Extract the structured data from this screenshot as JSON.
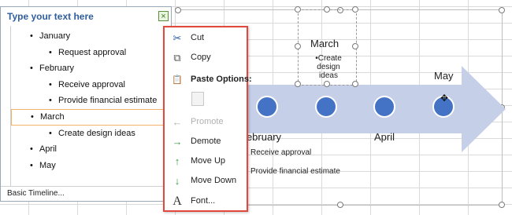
{
  "text_pane": {
    "title": "Type your text here",
    "close_glyph": "×",
    "items": [
      {
        "text": "January",
        "level": 1
      },
      {
        "text": "Request approval",
        "level": 2
      },
      {
        "text": "February",
        "level": 1
      },
      {
        "text": "Receive approval",
        "level": 2
      },
      {
        "text": "Provide financial estimate",
        "level": 2
      },
      {
        "text": "March",
        "level": 1
      },
      {
        "text": "Create design ideas",
        "level": 2
      },
      {
        "text": "April",
        "level": 1
      },
      {
        "text": "May",
        "level": 1
      }
    ],
    "footer": "Basic Timeline..."
  },
  "context_menu": {
    "cut": {
      "label": "Cut",
      "icon": "scissors-icon",
      "glyph": "✂"
    },
    "copy": {
      "label": "Copy",
      "icon": "copy-icon",
      "glyph": "⧉"
    },
    "paste_options": {
      "label": "Paste Options:",
      "icon": "clipboard-icon",
      "glyph": "📋"
    },
    "promote": {
      "label": "Promote",
      "icon": "arrow-left-icon",
      "glyph": "←",
      "enabled": false
    },
    "demote": {
      "label": "Demote",
      "icon": "arrow-right-icon",
      "glyph": "→"
    },
    "move_up": {
      "label": "Move Up",
      "icon": "arrow-up-icon",
      "glyph": "↑"
    },
    "move_down": {
      "label": "Move Down",
      "icon": "arrow-down-icon",
      "glyph": "↓"
    },
    "font": {
      "label": "Font...",
      "icon": "font-icon",
      "glyph": "A"
    }
  },
  "timeline": {
    "march": {
      "title": "March",
      "bullet": "•Create design ideas"
    },
    "may": "May",
    "april": "April",
    "february": "February",
    "feb_details": [
      "Receive approval",
      "Provide financial estimate"
    ]
  },
  "colors": {
    "arrow": "#c5cfe8",
    "circle": "#4472c4",
    "menu_border": "#e2483b",
    "icon_green": "#3a9a4a"
  }
}
